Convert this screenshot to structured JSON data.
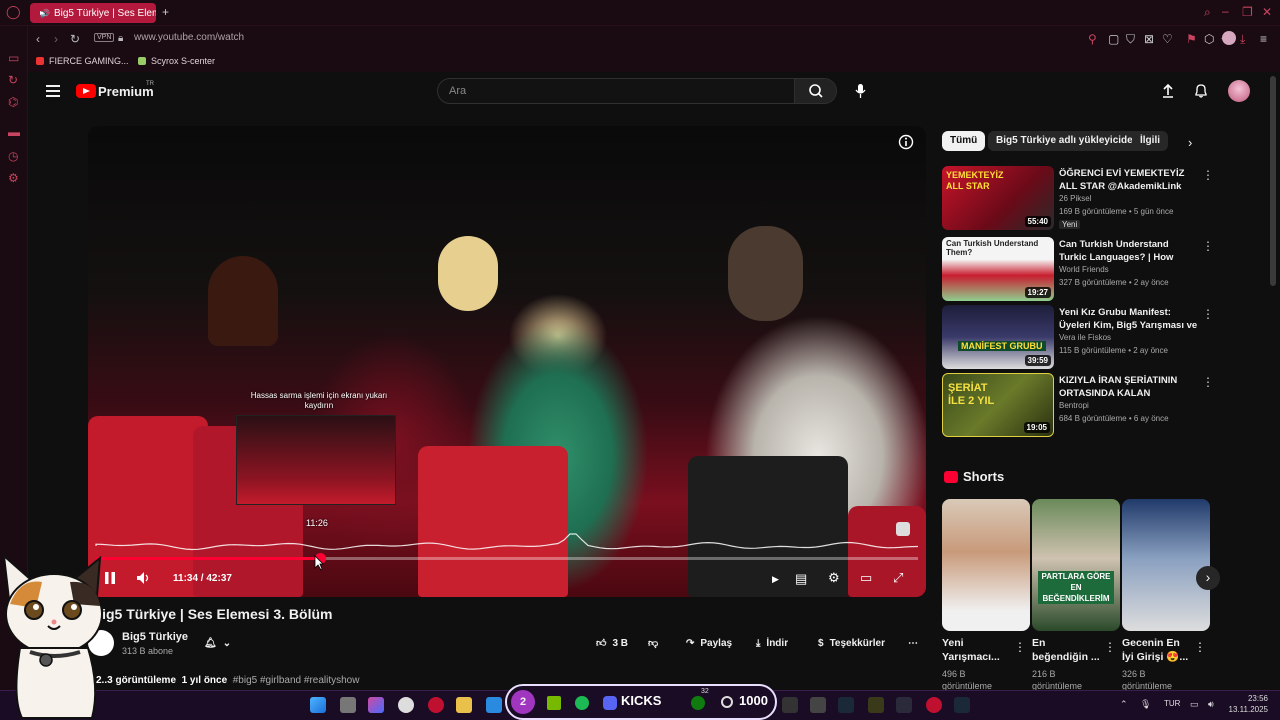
{
  "browser": {
    "tab_title": "Big5 Türkiye | Ses Elemesi 3. Bölüm",
    "new_tab": "+",
    "vpn_badge": "VPN",
    "url": "www.youtube.com/watch",
    "bookmarks": [
      "FIERCE GAMING...",
      "Scyrox S-center"
    ]
  },
  "youtube": {
    "brand": "Premium",
    "brand_country": "TR",
    "search_placeholder": "Ara"
  },
  "player": {
    "preview_hint": "Hassas sarma işlemi için ekranı yukarı kaydırın",
    "preview_time": "11:26",
    "time_display": "11:34 / 42:37",
    "progress_fraction": 0.272
  },
  "video": {
    "title": "Big5 Türkiye | Ses Elemesi 3. Bölüm",
    "channel": "Big5 Türkiye",
    "subscribers": "313 B abone",
    "likes": "3 B",
    "share": "Paylaş",
    "download": "İndir",
    "thanks": "Teşekkürler",
    "views": "2..3 görüntüleme",
    "age": "1 yıl önce",
    "tags": "#big5 #girlband #realityshow"
  },
  "sidebar": {
    "chips": [
      "Tümü",
      "Big5 Türkiye adlı yükleyiciden",
      "İlgili"
    ],
    "recommendations": [
      {
        "title": "ÖĞRENCİ EVİ YEMEKTEYİZ ALL STAR @AkademikLink",
        "channel": "26 Piksel",
        "meta": "169 B görüntüleme • 5 gün önce",
        "badge": "Yeni",
        "duration": "55:40",
        "thumb_text": "YEMEKTEYİZ ALL STAR"
      },
      {
        "title": "Can Turkish Understand Turkic Languages? | How Similar Are ...",
        "channel": "World Friends",
        "meta": "327 B görüntüleme • 2 ay önce",
        "duration": "19:27",
        "thumb_text": "Can Turkish Understand Them?"
      },
      {
        "title": "Yeni Kız Grubu Manifest: Üyeleri Kim, Big5 Yarışması ve Tüm ...",
        "channel": "Vera ile Fiskos",
        "meta": "115 B görüntüleme • 2 ay önce",
        "duration": "39:59",
        "thumb_text": "MANİFEST GRUBU"
      },
      {
        "title": "KIZIYLA İRAN ŞERİATININ ORTASINDA KALAN AMERİKA...",
        "channel": "Bentropi",
        "meta": "684 B görüntüleme • 6 ay önce",
        "duration": "19:05",
        "thumb_text": "ŞERİAT İLE 2 YIL"
      }
    ],
    "shorts_heading": "Shorts",
    "shorts": [
      {
        "title": "Yeni Yarışmacı...",
        "views": "496 B görüntüleme"
      },
      {
        "title": "En beğendiğin ...",
        "views": "216 B görüntüleme",
        "thumb_text": "PARTLARA GÖRE EN BEĞENDİKLERİM"
      },
      {
        "title": "Gecenin En İyi Girişi 😍...",
        "views": "326 B görüntüleme"
      }
    ]
  },
  "taskbar": {
    "badge_count": "2",
    "kicks_label": "KICKS",
    "counter": "1000",
    "lang": "TUR",
    "time": "23:56",
    "date": "13.11.2025",
    "xbox_badge": "32"
  },
  "colors": {
    "accent": "#ff0033",
    "tab": "#b3193d",
    "chrome": "#1a0b12",
    "taskbar": "#1a0c24"
  }
}
